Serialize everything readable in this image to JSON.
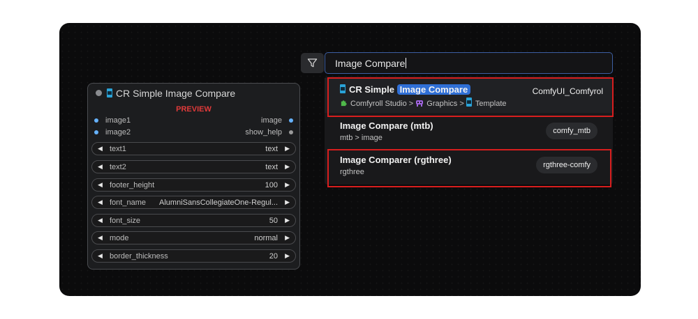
{
  "node": {
    "title": "CR Simple Image Compare",
    "preview_label": "PREVIEW",
    "inputs": [
      {
        "label": "image1",
        "output": "image"
      },
      {
        "label": "image2",
        "output": "show_help"
      }
    ],
    "widgets": [
      {
        "name": "text1",
        "value": "text"
      },
      {
        "name": "text2",
        "value": "text"
      },
      {
        "name": "footer_height",
        "value": "100"
      },
      {
        "name": "font_name",
        "value": "AlumniSansCollegiateOne-Regul..."
      },
      {
        "name": "font_size",
        "value": "50"
      },
      {
        "name": "mode",
        "value": "normal"
      },
      {
        "name": "border_thickness",
        "value": "20"
      }
    ],
    "colors": {
      "image_socket": "#66b2ff",
      "help_socket": "#9a9a9a",
      "preview": "#e03a3a"
    }
  },
  "search": {
    "query": "Image Compare",
    "filter_icon": "filter-icon"
  },
  "results": [
    {
      "title_prefix": "CR Simple",
      "title_highlight": "Image Compare",
      "breadcrumb": [
        "Comfyroll Studio",
        "Graphics",
        "Template"
      ],
      "separator": ">",
      "badge": "ComfyUI_Comfyrol"
    },
    {
      "title": "Image Compare (mtb)",
      "subtitle": "mtb > image",
      "badge": "comfy_mtb"
    },
    {
      "title": "Image Comparer (rgthree)",
      "subtitle": "rgthree",
      "badge": "rgthree-comfy"
    }
  ],
  "accent": {
    "highlight": "#2f6fd6",
    "annotation": "#d81e1e"
  }
}
